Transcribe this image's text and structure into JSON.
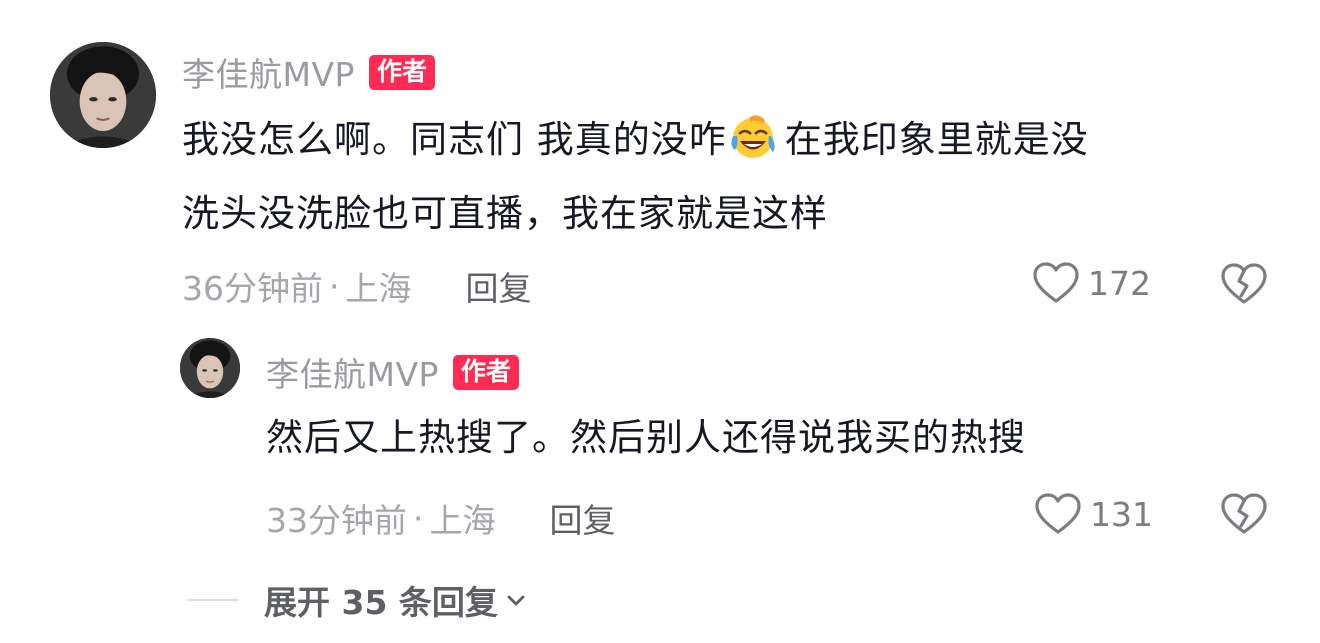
{
  "comment": {
    "username": "李佳航MVP",
    "badge": "作者",
    "lines": [
      "我没怎么啊。同志们 我真的没咋",
      "在我印象里就是没",
      "洗头没洗脸也可直播，我在家就是这样"
    ],
    "emoji": "laughing-crying-face",
    "time": "36分钟前",
    "separator": "·",
    "location": "上海",
    "reply_label": "回复",
    "likes": "172"
  },
  "reply": {
    "username": "李佳航MVP",
    "badge": "作者",
    "text": "然后又上热搜了。然后别人还得说我买的热搜",
    "time": "33分钟前",
    "separator": "·",
    "location": "上海",
    "reply_label": "回复",
    "likes": "131"
  },
  "expand": {
    "label": "展开 35 条回复"
  },
  "colors": {
    "badge": "#fe2c55",
    "username": "#9a9ba0",
    "text": "#161823",
    "meta": "#a5a6ab"
  }
}
